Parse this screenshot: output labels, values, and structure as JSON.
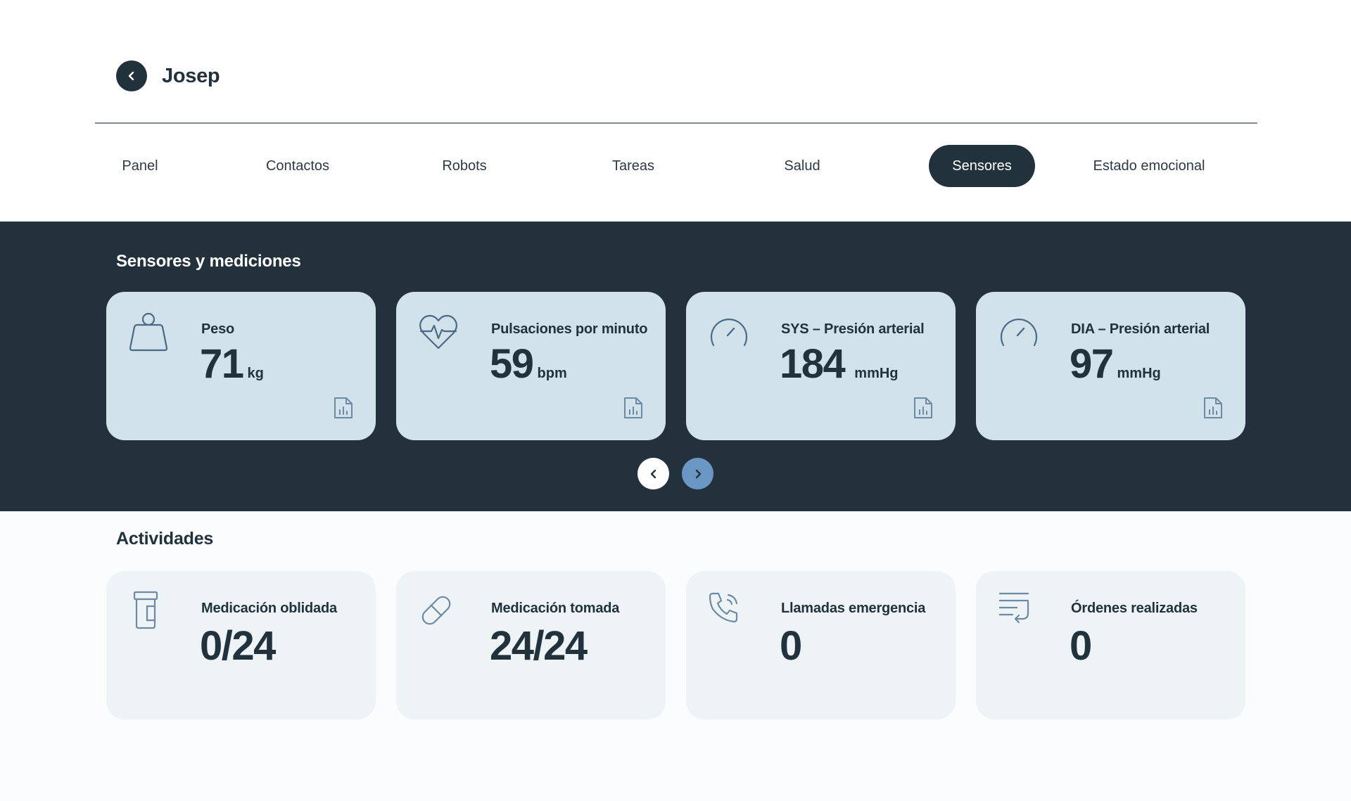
{
  "header": {
    "user_name": "Josep"
  },
  "tabs": [
    {
      "label": "Panel"
    },
    {
      "label": "Contactos"
    },
    {
      "label": "Robots"
    },
    {
      "label": "Tareas"
    },
    {
      "label": "Salud"
    },
    {
      "label": "Sensores",
      "active": true
    },
    {
      "label": "Estado emocional"
    }
  ],
  "sensors": {
    "title": "Sensores y mediciones",
    "cards": [
      {
        "icon": "weight-icon",
        "label": "Peso",
        "value": "71",
        "unit": "kg"
      },
      {
        "icon": "heart-pulse-icon",
        "label": "Pulsaciones por minuto",
        "value": "59",
        "unit": "bpm"
      },
      {
        "icon": "gauge-icon",
        "label": "SYS – Presión arterial",
        "value": "184",
        "unit": "mmHg"
      },
      {
        "icon": "gauge-icon",
        "label": "DIA – Presión arterial",
        "value": "97",
        "unit": "mmHg"
      }
    ]
  },
  "activities": {
    "title": "Actividades",
    "cards": [
      {
        "icon": "pill-bottle-icon",
        "label": "Medicación oblidada",
        "value": "0/24"
      },
      {
        "icon": "pill-icon",
        "label": "Medicación tomada",
        "value": "24/24"
      },
      {
        "icon": "phone-call-icon",
        "label": "Llamadas emergencia",
        "value": "0"
      },
      {
        "icon": "list-return-icon",
        "label": "Órdenes realizadas",
        "value": "0"
      }
    ]
  },
  "colors": {
    "dark": "#22313b",
    "sensor_card": "#d1e2ea",
    "activity_card": "#eef3f6",
    "accent_blue": "#6a97c4",
    "icon_stroke": "#4a6a86"
  }
}
